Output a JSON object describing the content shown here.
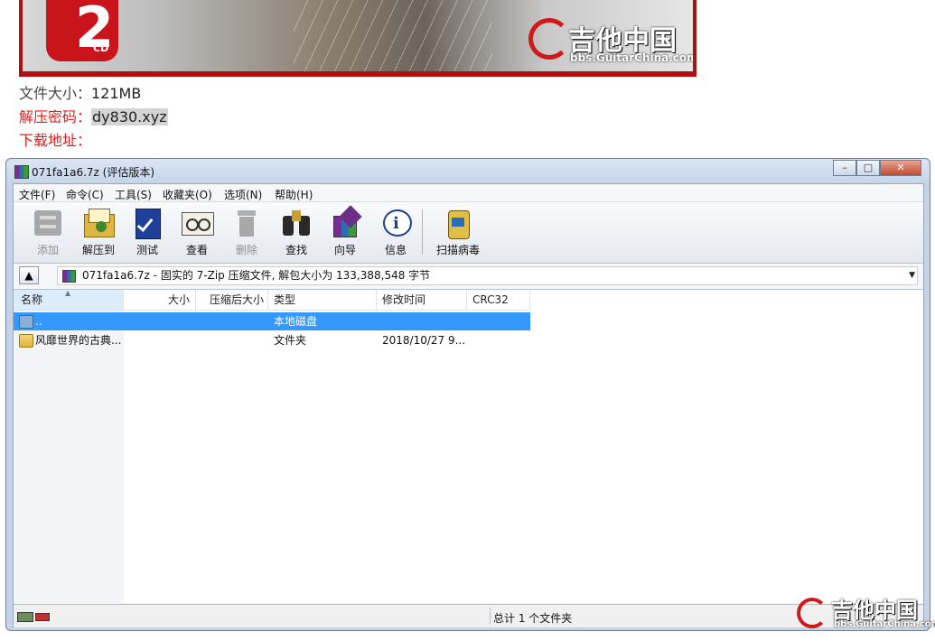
{
  "banner": {
    "cd_number": "2",
    "cd_label": "CD",
    "logo_cn": "吉他中国",
    "logo_en": "bbs.GuitarChina.com"
  },
  "info": {
    "size_label": "文件大小：",
    "size_value": "121MB",
    "password_label": "解压密码：",
    "password_value": "dy830.xyz",
    "download_label": "下载地址："
  },
  "window": {
    "title": "071fa1a6.7z (评估版本)",
    "controls": {
      "minimize": "–",
      "maximize": "□",
      "close": "✕"
    },
    "menu": [
      "文件(F)",
      "命令(C)",
      "工具(S)",
      "收藏夹(O)",
      "选项(N)",
      "帮助(H)"
    ],
    "toolbar": [
      {
        "label": "添加",
        "icon": "add-icon",
        "enabled": false
      },
      {
        "label": "解压到",
        "icon": "extract-icon",
        "enabled": true
      },
      {
        "label": "测试",
        "icon": "test-icon",
        "enabled": true
      },
      {
        "label": "查看",
        "icon": "view-icon",
        "enabled": true
      },
      {
        "label": "删除",
        "icon": "delete-icon",
        "enabled": false
      },
      {
        "label": "查找",
        "icon": "find-icon",
        "enabled": true
      },
      {
        "label": "向导",
        "icon": "wizard-icon",
        "enabled": true
      },
      {
        "label": "信息",
        "icon": "info-icon",
        "enabled": true
      },
      {
        "label": "扫描病毒",
        "icon": "virus-scan-icon",
        "enabled": true
      }
    ],
    "address": "071fa1a6.7z - 固实的 7-Zip 压缩文件, 解包大小为 133,388,548 字节",
    "columns": [
      "名称",
      "大小",
      "压缩后大小",
      "类型",
      "修改时间",
      "CRC32"
    ],
    "rows": [
      {
        "name": "..",
        "size": "",
        "packed": "",
        "type": "本地磁盘",
        "modified": "",
        "crc": "",
        "selected": true
      },
      {
        "name": "风靡世界的古典...",
        "size": "",
        "packed": "",
        "type": "文件夹",
        "modified": "2018/10/27 9...",
        "crc": "",
        "selected": false
      }
    ],
    "status": "总计 1 个文件夹",
    "watermark_cn": "吉他中国",
    "watermark_en": "bbs.GuitarChina.com"
  },
  "colors": {
    "accent_red": "#e02020",
    "selection": "#3399ff",
    "logo_red": "#d01a1a"
  }
}
